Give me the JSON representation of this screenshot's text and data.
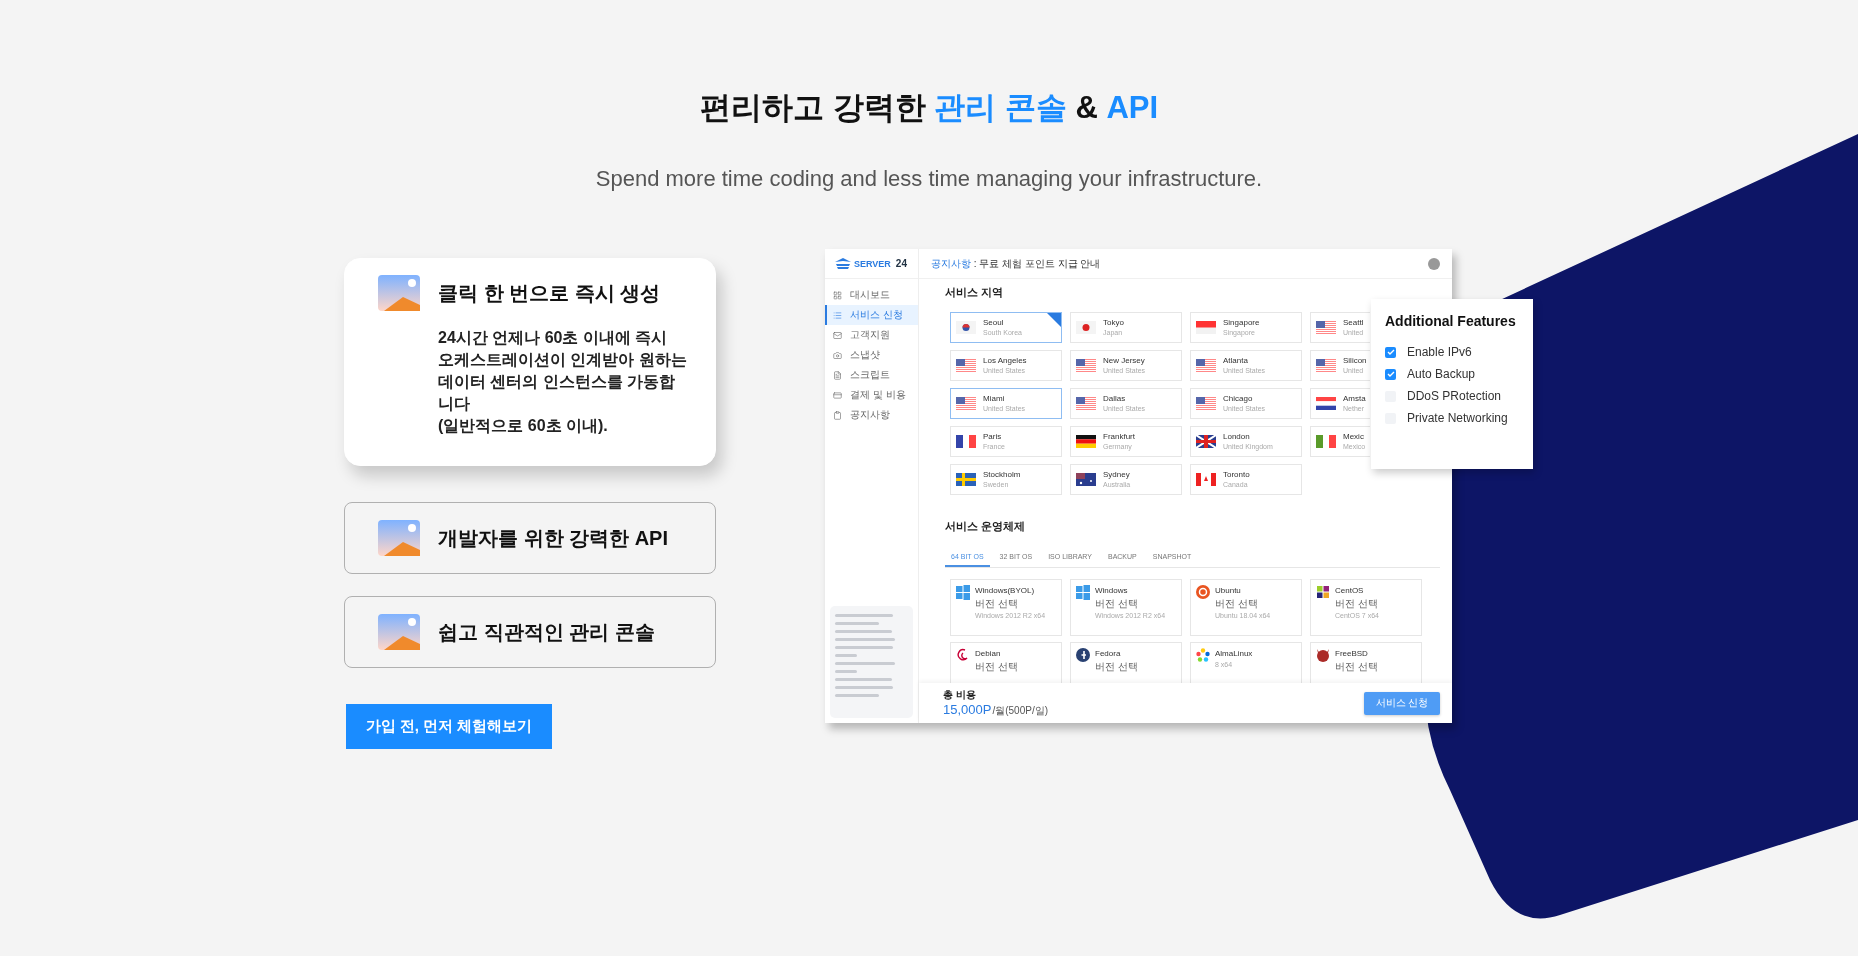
{
  "heading": [
    {
      "text": "편리하고 강력한 ",
      "highlight": false
    },
    {
      "text": "관리 콘솔",
      "highlight": true
    },
    {
      "text": " & ",
      "highlight": false
    },
    {
      "text": "API",
      "highlight": true
    }
  ],
  "subtitle": "Spend more time coding and less time managing your infrastructure.",
  "features": [
    {
      "title": "클릭 한 번으로 즉시 생성",
      "description_lines": [
        "24시간 언제나 60초 이내에 즉시",
        "오케스트레이션이 인계받아 원하는",
        "데이터 센터의 인스턴스를 가동합니다",
        "(일반적으로 60초 이내)."
      ],
      "selected": true
    },
    {
      "title": "개발자를 위한 강력한 API",
      "selected": false
    },
    {
      "title": "쉽고 직관적인 관리 콘솔",
      "selected": false
    }
  ],
  "cta": "가입 전, 먼저 체험해보기",
  "console": {
    "logo": {
      "text": "SERVER",
      "number": "24"
    },
    "sidebar": [
      {
        "label": "대시보드",
        "selected": false
      },
      {
        "label": "서비스 신청",
        "selected": true
      },
      {
        "label": "고객지원",
        "selected": false
      },
      {
        "label": "스냅샷",
        "selected": false
      },
      {
        "label": "스크립트",
        "selected": false
      },
      {
        "label": "결제 및 비용",
        "selected": false
      },
      {
        "label": "공지사항",
        "selected": false
      }
    ],
    "notice": {
      "label": "공지사항",
      "text": " : 무료 체험 포인트 지급 안내"
    },
    "regions_title": "서비스 지역",
    "regions": [
      {
        "city": "Seoul",
        "country": "South Korea",
        "kind": "kr",
        "selected": true,
        "hovered": false
      },
      {
        "city": "Tokyo",
        "country": "Japan",
        "kind": "jp",
        "selected": false,
        "hovered": false
      },
      {
        "city": "Singapore",
        "country": "Singapore",
        "kind": "sg",
        "selected": false,
        "hovered": false
      },
      {
        "city": "Seattl",
        "country": "United",
        "kind": "us",
        "selected": false,
        "hovered": false
      },
      {
        "city": "Los Angeles",
        "country": "United States",
        "kind": "us",
        "selected": false,
        "hovered": false
      },
      {
        "city": "New Jersey",
        "country": "United States",
        "kind": "us",
        "selected": false,
        "hovered": false
      },
      {
        "city": "Atlanta",
        "country": "United States",
        "kind": "us",
        "selected": false,
        "hovered": false
      },
      {
        "city": "Silicon",
        "country": "United",
        "kind": "us",
        "selected": false,
        "hovered": false
      },
      {
        "city": "Miami",
        "country": "United States",
        "kind": "us",
        "selected": false,
        "hovered": true
      },
      {
        "city": "Dallas",
        "country": "United States",
        "kind": "us",
        "selected": false,
        "hovered": false
      },
      {
        "city": "Chicago",
        "country": "United States",
        "kind": "us",
        "selected": false,
        "hovered": false
      },
      {
        "city": "Amsta",
        "country": "Nether",
        "kind": "nl",
        "selected": false,
        "hovered": false
      },
      {
        "city": "Paris",
        "country": "France",
        "kind": "fr",
        "selected": false,
        "hovered": false
      },
      {
        "city": "Frankfurt",
        "country": "Germany",
        "kind": "de",
        "selected": false,
        "hovered": false
      },
      {
        "city": "London",
        "country": "United Kingdom",
        "kind": "gb",
        "selected": false,
        "hovered": false
      },
      {
        "city": "Mexic",
        "country": "Mexico",
        "kind": "mx",
        "selected": false,
        "hovered": false
      },
      {
        "city": "Stockholm",
        "country": "Sweden",
        "kind": "se",
        "selected": false,
        "hovered": false
      },
      {
        "city": "Sydney",
        "country": "Australia",
        "kind": "au",
        "selected": false,
        "hovered": false
      },
      {
        "city": "Toronto",
        "country": "Canada",
        "kind": "ca",
        "selected": false,
        "hovered": false
      }
    ],
    "os_title": "서비스 운영체제",
    "os_tabs": [
      {
        "label": "64 BIT OS",
        "selected": true
      },
      {
        "label": "32 BIT OS",
        "selected": false
      },
      {
        "label": "ISO LIBRARY",
        "selected": false
      },
      {
        "label": "BACKUP",
        "selected": false
      },
      {
        "label": "SNAPSHOT",
        "selected": false
      }
    ],
    "os": [
      {
        "name": "Windows(BYOL)",
        "kind": "windows",
        "version_label": "버전 선택",
        "version": "Windows 2012 R2 x64"
      },
      {
        "name": "Windows",
        "kind": "windows",
        "version_label": "버전 선택",
        "version": "Windows 2012 R2 x64"
      },
      {
        "name": "Ubuntu",
        "kind": "ubuntu",
        "version_label": "버전 선택",
        "version": "Ubuntu 18.04 x64"
      },
      {
        "name": "CentOS",
        "kind": "centos",
        "version_label": "버전 선택",
        "version": "CentOS 7 x64"
      },
      {
        "name": "Debian",
        "kind": "debian",
        "version_label": "버전 선택"
      },
      {
        "name": "Fedora",
        "kind": "fedora",
        "version_label": "버전 선택"
      },
      {
        "name": "AlmaLinux",
        "kind": "almalinux",
        "version": "8 x64"
      },
      {
        "name": "FreeBSD",
        "kind": "freebsd",
        "version_label": "버전 선택"
      }
    ],
    "total_label": "총 비용",
    "price": "15,000P",
    "price_unit": "/월(500P/일)",
    "apply_button": "서비스 신청"
  },
  "features_panel": {
    "title": "Additional Features",
    "options": [
      {
        "label": "Enable IPv6",
        "checked": true
      },
      {
        "label": "Auto Backup",
        "checked": true
      },
      {
        "label": "DDoS PRotection",
        "checked": false
      },
      {
        "label": "Private Networking",
        "checked": false
      }
    ]
  }
}
